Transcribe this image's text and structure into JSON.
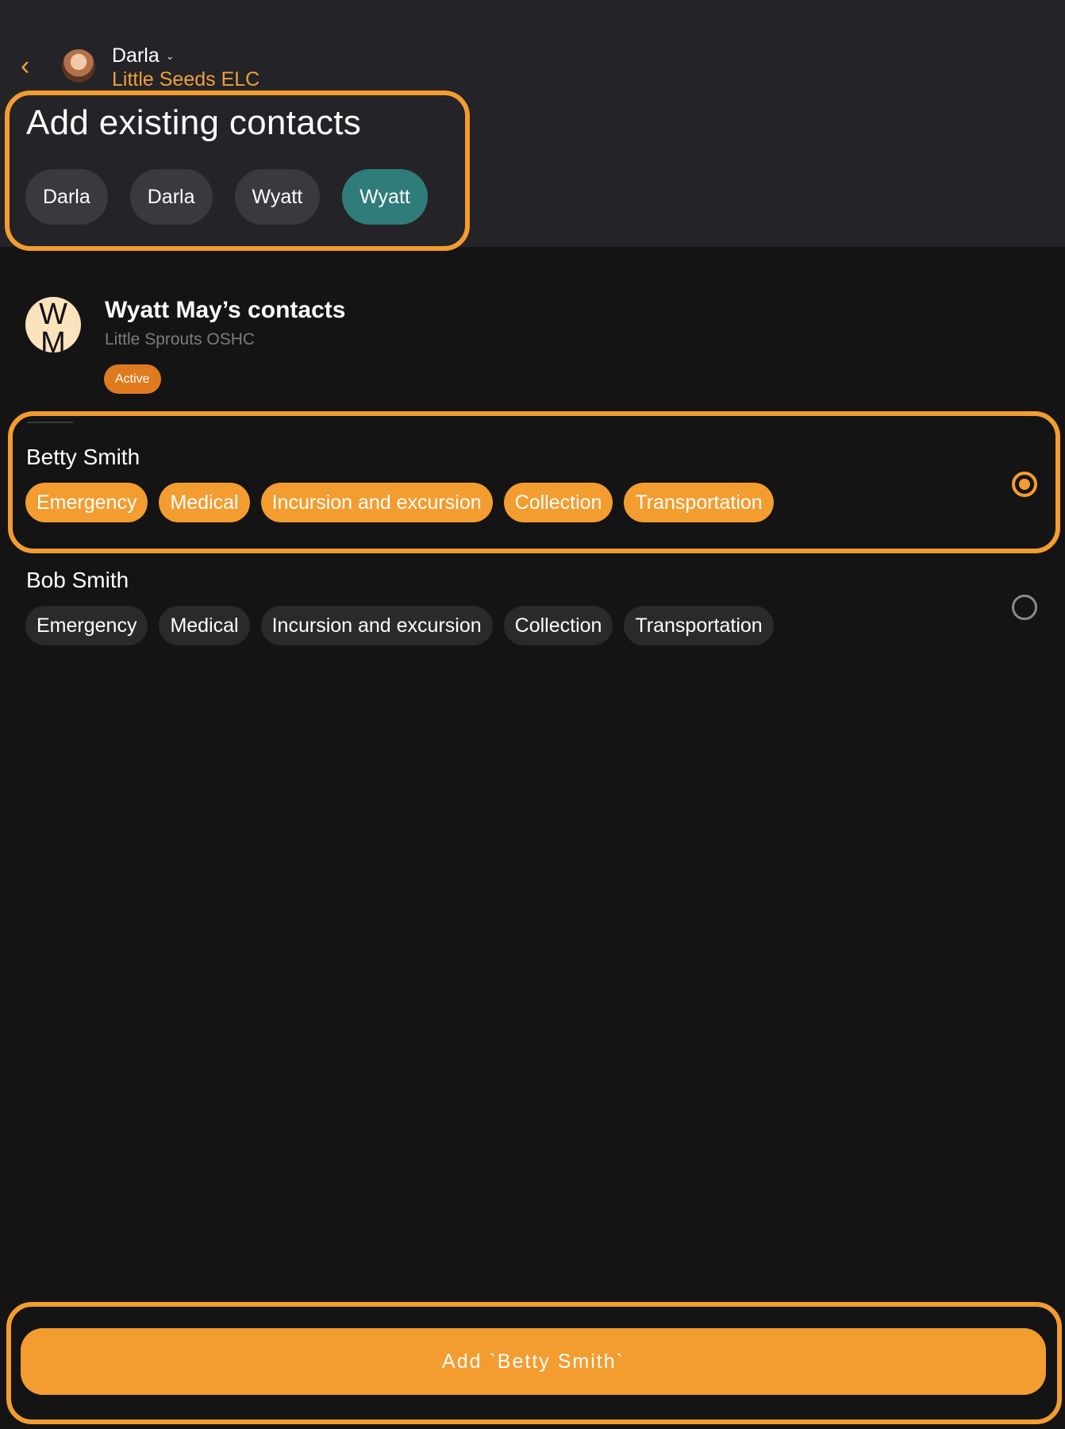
{
  "header": {
    "child_name": "Darla",
    "service_name": "Little Seeds ELC",
    "back_icon": "chevron-left-icon",
    "dropdown_icon": "chevron-down-icon"
  },
  "page_title": "Add existing contacts",
  "child_chips": [
    {
      "label": "Darla",
      "selected": false
    },
    {
      "label": "Darla",
      "selected": false
    },
    {
      "label": "Wyatt",
      "selected": false
    },
    {
      "label": "Wyatt",
      "selected": true
    }
  ],
  "group": {
    "avatar_initials": "W M",
    "title": "Wyatt May’s contacts",
    "subtitle": "Little Sprouts OSHC",
    "status": "Active"
  },
  "contacts": [
    {
      "name": "Betty Smith",
      "selected": true,
      "tags": [
        "Emergency",
        "Medical",
        "Incursion and excursion",
        "Collection",
        "Transportation"
      ]
    },
    {
      "name": "Bob Smith",
      "selected": false,
      "tags": [
        "Emergency",
        "Medical",
        "Incursion and excursion",
        "Collection",
        "Transportation"
      ]
    }
  ],
  "primary_button_label": "Add `Betty Smith`",
  "colors": {
    "accent": "#f39c2f",
    "selected_chip": "#2f7c7a",
    "header_bg": "#232328",
    "page_bg": "#141414"
  }
}
